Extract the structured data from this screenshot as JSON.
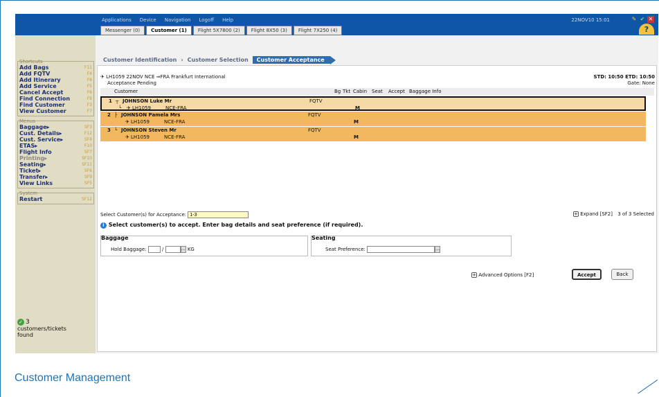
{
  "menu": [
    "Applications",
    "Device",
    "Navigation",
    "Logoff",
    "Help"
  ],
  "clock": "22NOV10 15:01",
  "tabs": [
    "Messenger (0)",
    "Customer (1)",
    "Flight 5X7800 (2)",
    "Flight 8X50 (3)",
    "Flight 7X250 (4)"
  ],
  "breadcrumbs": [
    "Customer Identification",
    "Customer Selection",
    "Customer Acceptance"
  ],
  "sidebar": {
    "shortcuts_label": "Shortcuts",
    "shortcuts": [
      [
        "Add Bags",
        "F11"
      ],
      [
        "Add FQTV",
        "F4"
      ],
      [
        "Add Itinerary",
        "F8"
      ],
      [
        "Add Service",
        "F5"
      ],
      [
        "Cancel Accept",
        "F6"
      ],
      [
        "Find Connection",
        "F9"
      ],
      [
        "Find Customer",
        "F3"
      ],
      [
        "View Customer",
        "F7"
      ]
    ],
    "menus_label": "Menus",
    "menus": [
      [
        "Baggage▸",
        "SF3"
      ],
      [
        "Cust. Details▸",
        "F12"
      ],
      [
        "Cust. Service▸",
        "SF4"
      ],
      [
        "ETAS▸",
        "F10"
      ],
      [
        "Flight Info",
        "SF7"
      ],
      [
        "Printing▸",
        "SF10"
      ],
      [
        "Seating▸",
        "SF11"
      ],
      [
        "Ticket▸",
        "SF6"
      ],
      [
        "Transfer▸",
        "SF9"
      ],
      [
        "View Links",
        "SF5"
      ]
    ],
    "system_label": "System",
    "system": [
      [
        "Restart",
        "SF12"
      ]
    ],
    "status_count": "3",
    "status_text": "customers/tickets found"
  },
  "flight": {
    "line1": "LH1059 22NOV NCE ⇒FRA Frankfurt International",
    "line2": "Acceptance Pending",
    "std": "STD: 10:50 ETD: 10:50",
    "gate": "Gate: None"
  },
  "table": {
    "headers": {
      "customer": "Customer",
      "bg": "Bg",
      "tkt": "Tkt",
      "cabin": "Cabin",
      "seat": "Seat",
      "accept": "Accept",
      "baggage": "Baggage Info"
    },
    "rows": [
      {
        "num": "1",
        "name": "JOHNSON Luke Mr",
        "fqtv": "FQTV",
        "flight": "LH1059",
        "route": "NCE-FRA",
        "cabin": "M"
      },
      {
        "num": "2",
        "name": "JOHNSON Pamela Mrs",
        "fqtv": "FQTV",
        "flight": "LH1059",
        "route": "NCE-FRA",
        "cabin": "M"
      },
      {
        "num": "3",
        "name": "JOHNSON Steven Mr",
        "fqtv": "FQTV",
        "flight": "LH1059",
        "route": "NCE-FRA",
        "cabin": "M"
      }
    ]
  },
  "select": {
    "label": "Select Customer(s) for Acceptance:",
    "value": "1-3",
    "expand": "Expand [SF2]",
    "count": "3 of 3 Selected"
  },
  "message": "Select customer(s) to accept. Enter bag details and seat preference (if required).",
  "baggage": {
    "title": "Baggage",
    "hold_label": "Hold Baggage:",
    "unit": "KG"
  },
  "seating": {
    "title": "Seating",
    "pref_label": "Seat Preference:"
  },
  "advanced": "Advanced Options [F2]",
  "accept": "Accept",
  "back": "Back",
  "caption": "Customer Management"
}
